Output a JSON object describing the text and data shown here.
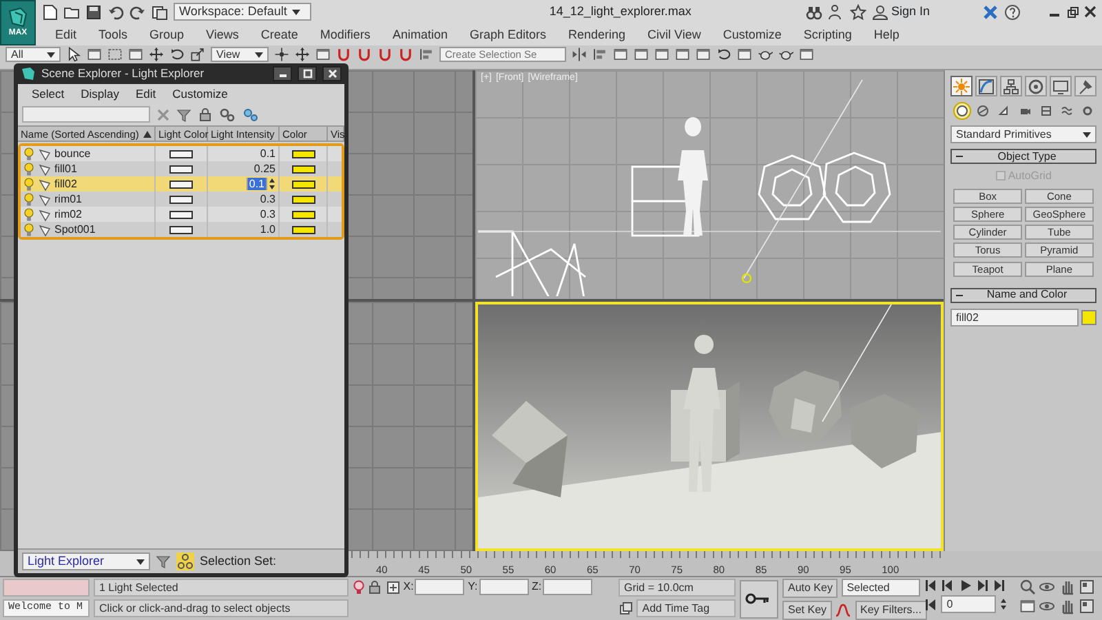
{
  "title_bar": {
    "logo_text": "MAX",
    "workspace": "Workspace: Default",
    "file_title": "14_12_light_explorer.max",
    "sign_in": "Sign In"
  },
  "menu": [
    "Edit",
    "Tools",
    "Group",
    "Views",
    "Create",
    "Modifiers",
    "Animation",
    "Graph Editors",
    "Rendering",
    "Civil View",
    "Customize",
    "Scripting",
    "Help"
  ],
  "toolbar": {
    "selection_filter": "All",
    "reference_coord": "View",
    "selection_set": {
      "placeholder": "Create Selection Se"
    }
  },
  "viewports": [
    {
      "kind": "grid",
      "active": false
    },
    {
      "kind": "front",
      "active": false,
      "labels": [
        "[+]",
        "[Front]",
        "[Wireframe]"
      ]
    },
    {
      "kind": "grid",
      "active": false
    },
    {
      "kind": "perspective",
      "active": true
    }
  ],
  "scene_explorer": {
    "title": "Scene Explorer - Light Explorer",
    "menu": [
      "Select",
      "Display",
      "Edit",
      "Customize"
    ],
    "columns": [
      "Name (Sorted Ascending)",
      "Light Color",
      "Light Intensity",
      "Color",
      "Vis"
    ],
    "rows": [
      {
        "name": "bounce",
        "intensity": "0.1",
        "selected": false,
        "editing": false
      },
      {
        "name": "fill01",
        "intensity": "0.25",
        "selected": false,
        "editing": false
      },
      {
        "name": "fill02",
        "intensity": "0.1",
        "selected": true,
        "editing": true
      },
      {
        "name": "rim01",
        "intensity": "0.3",
        "selected": false,
        "editing": false
      },
      {
        "name": "rim02",
        "intensity": "0.3",
        "selected": false,
        "editing": false
      },
      {
        "name": "Spot001",
        "intensity": "1.0",
        "selected": false,
        "editing": false
      }
    ],
    "explorer_select": "Light Explorer",
    "selection_set_label": "Selection Set:"
  },
  "command_panel": {
    "tabs": [
      {
        "selected": true
      },
      {
        "selected": false
      },
      {
        "selected": false
      },
      {
        "selected": false
      },
      {
        "selected": false
      },
      {
        "selected": false
      }
    ],
    "categories": [
      {
        "selected": true
      },
      {
        "selected": false
      },
      {
        "selected": false
      },
      {
        "selected": false
      },
      {
        "selected": false
      },
      {
        "selected": false
      },
      {
        "selected": false
      }
    ],
    "dropdown": "Standard Primitives",
    "object_type": {
      "title": "Object Type",
      "autogrid": {
        "label": "AutoGrid",
        "checked": false,
        "disabled": true
      },
      "buttons": [
        "Box",
        "Cone",
        "Sphere",
        "GeoSphere",
        "Cylinder",
        "Tube",
        "Torus",
        "Pyramid",
        "Teapot",
        "Plane"
      ]
    },
    "name_and_color": {
      "title": "Name and Color",
      "name": "fill02"
    }
  },
  "timeline": {
    "ticks": [
      "40",
      "45",
      "50",
      "55",
      "60",
      "65",
      "70",
      "75",
      "80",
      "85",
      "90",
      "95",
      "100"
    ]
  },
  "status_bar": {
    "listener_text": "Welcome to M",
    "selection_info": "1 Light Selected",
    "prompt": "Click or click-and-drag to select objects",
    "coords": [
      "X:",
      "Y:",
      "Z:"
    ],
    "grid": "Grid = 10.0cm",
    "add_time_tag": "Add Time Tag",
    "auto_key": "Auto Key",
    "key_mode": "Selected",
    "set_key": "Set Key",
    "key_filters": "Key Filters...",
    "frame": "0"
  }
}
